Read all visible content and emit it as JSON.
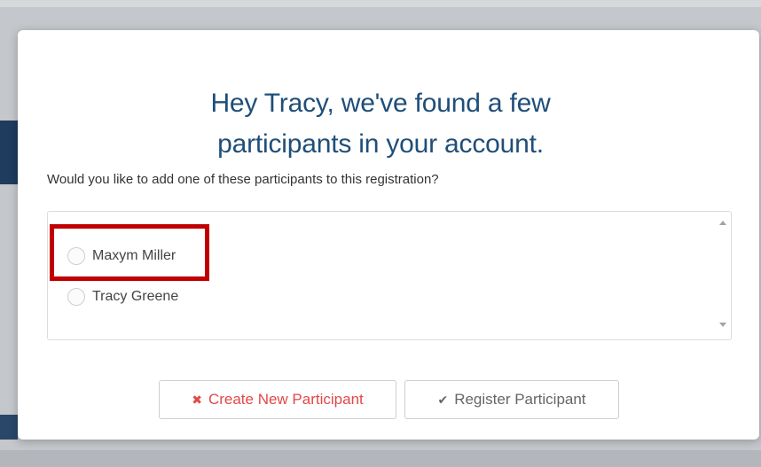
{
  "modal": {
    "title_line1": "Hey Tracy, we've found a few",
    "title_line2": "participants in your account.",
    "question": "Would you like to add one of these participants to this registration?"
  },
  "participants": [
    {
      "name": "Maxym Miller",
      "selected": false,
      "highlighted": true
    },
    {
      "name": "Tracy Greene",
      "selected": false,
      "highlighted": false
    }
  ],
  "buttons": {
    "create_label": "Create New Participant",
    "create_icon": "times-icon",
    "register_label": "Register Participant",
    "register_icon": "check-icon"
  },
  "colors": {
    "title": "#1f4e79",
    "create_text": "#e04848",
    "highlight": "#c00000"
  }
}
